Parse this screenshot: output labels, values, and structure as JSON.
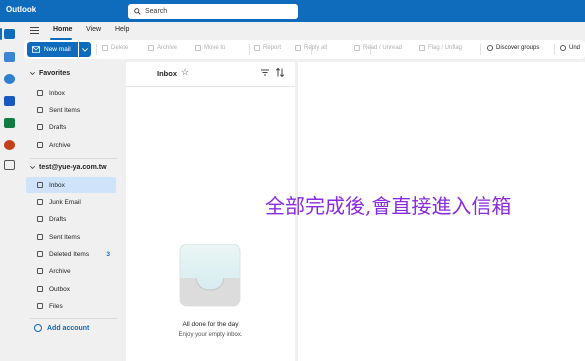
{
  "app": {
    "title": "Outlook"
  },
  "search": {
    "placeholder": "Search"
  },
  "ribbon": {
    "tabs": [
      {
        "label": "Home",
        "active": true
      },
      {
        "label": "View"
      },
      {
        "label": "Help"
      }
    ]
  },
  "toolbar": {
    "new_mail": "New mail",
    "delete": "Delete",
    "archive": "Archive",
    "move_to": "Move to",
    "report": "Report",
    "reply_all": "Reply all",
    "read_unread": "Read / Unread",
    "flag_unflag": "Flag / Unflag",
    "discover_groups": "Discover groups",
    "undo": "Und"
  },
  "favorites": {
    "heading": "Favorites",
    "items": [
      {
        "label": "Inbox"
      },
      {
        "label": "Sent Items"
      },
      {
        "label": "Drafts"
      },
      {
        "label": "Archive"
      }
    ]
  },
  "account": {
    "heading": "test@yue-ya.com.tw",
    "items": [
      {
        "label": "Inbox",
        "selected": true
      },
      {
        "label": "Junk Email"
      },
      {
        "label": "Drafts"
      },
      {
        "label": "Sent Items"
      },
      {
        "label": "Deleted Items",
        "count": "3"
      },
      {
        "label": "Archive"
      },
      {
        "label": "Outbox"
      },
      {
        "label": "Files"
      }
    ]
  },
  "add_account": "Add account",
  "message_list": {
    "title": "Inbox",
    "empty_title": "All done for the day",
    "empty_subtitle": "Enjoy your empty inbox."
  },
  "overlay_caption": "全部完成後,會直接進入信箱",
  "colors": {
    "brand": "#0f6cbd",
    "selected_folder": "#cfe4fa",
    "overlay_text": "#8a2be2"
  }
}
